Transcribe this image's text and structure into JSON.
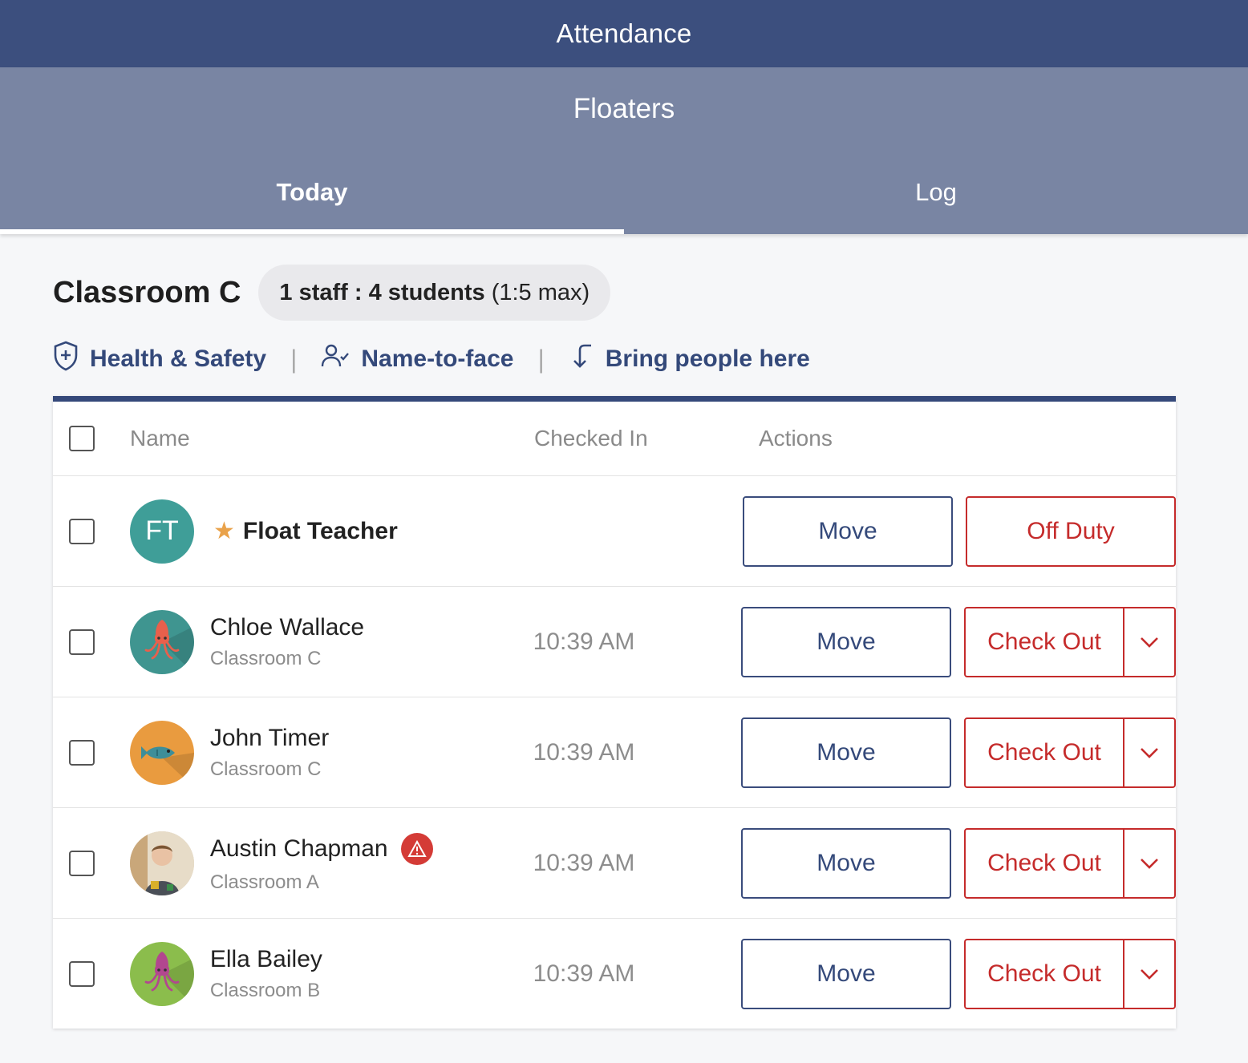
{
  "header": {
    "title": "Attendance"
  },
  "subheader": {
    "title": "Floaters"
  },
  "tabs": [
    {
      "label": "Today",
      "active": true
    },
    {
      "label": "Log",
      "active": false
    }
  ],
  "room": {
    "title": "Classroom C",
    "ratio_bold": "1 staff : 4 students",
    "ratio_rest": "(1:5 max)"
  },
  "links": {
    "health": "Health & Safety",
    "name_to_face": "Name-to-face",
    "bring": "Bring people here",
    "separator": "|"
  },
  "table": {
    "columns": {
      "name": "Name",
      "checked_in": "Checked In",
      "actions": "Actions"
    },
    "staff": {
      "initials": "FT",
      "name": "Float Teacher",
      "move_label": "Move",
      "off_duty_label": "Off Duty"
    },
    "students": [
      {
        "name": "Chloe Wallace",
        "classroom": "Classroom C",
        "checked_in": "10:39 AM",
        "avatar": "squid-icon",
        "avatar_bg": "#3f9590",
        "move_label": "Move",
        "checkout_label": "Check Out"
      },
      {
        "name": "John Timer",
        "classroom": "Classroom C",
        "checked_in": "10:39 AM",
        "avatar": "fish-icon",
        "avatar_bg": "#e99b3f",
        "move_label": "Move",
        "checkout_label": "Check Out"
      },
      {
        "name": "Austin Chapman",
        "classroom": "Classroom A",
        "checked_in": "10:39 AM",
        "avatar": "photo-avatar",
        "alert": true,
        "move_label": "Move",
        "checkout_label": "Check Out"
      },
      {
        "name": "Ella Bailey",
        "classroom": "Classroom B",
        "checked_in": "10:39 AM",
        "avatar": "squid-icon",
        "avatar_bg": "#8bbd4c",
        "move_label": "Move",
        "checkout_label": "Check Out"
      }
    ]
  },
  "colors": {
    "topbar": "#3c4f7e",
    "subbar": "#7985a3",
    "primary": "#34497a",
    "danger": "#c52b2b",
    "star": "#e9a24a"
  }
}
